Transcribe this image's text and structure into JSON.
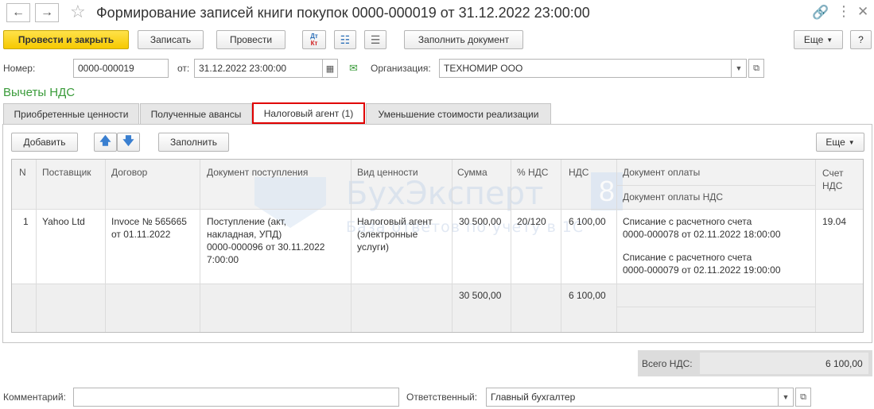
{
  "window": {
    "title": "Формирование записей книги покупок 0000-000019 от 31.12.2022 23:00:00"
  },
  "toolbar": {
    "post_close_label": "Провести и закрыть",
    "save_label": "Записать",
    "post_label": "Провести",
    "dt_label": "Дт",
    "kt_label": "Кт",
    "fill_doc_label": "Заполнить документ",
    "more_label": "Еще",
    "help_label": "?"
  },
  "header": {
    "number_label": "Номер:",
    "number_value": "0000-000019",
    "date_label": "от:",
    "date_value": "31.12.2022 23:00:00",
    "org_label": "Организация:",
    "org_value": "ТЕХНОМИР ООО"
  },
  "section_title": "Вычеты НДС",
  "tabs": [
    {
      "label": "Приобретенные ценности"
    },
    {
      "label": "Полученные авансы"
    },
    {
      "label": "Налоговый агент (1)"
    },
    {
      "label": "Уменьшение стоимости реализации"
    }
  ],
  "table_toolbar": {
    "add_label": "Добавить",
    "fill_label": "Заполнить",
    "more_label": "Еще"
  },
  "table": {
    "columns": {
      "n": "N",
      "supplier": "Поставщик",
      "contract": "Договор",
      "receipt_doc": "Документ поступления",
      "value_type": "Вид ценности",
      "amount": "Сумма",
      "vat_rate": "% НДС",
      "vat": "НДС",
      "payment_doc": "Документ оплаты",
      "payment_doc_vat": "Документ оплаты НДС",
      "vat_account": "Счет НДС"
    },
    "rows": [
      {
        "n": "1",
        "supplier": "Yahoo Ltd",
        "contract_1": "Invoce № 565665",
        "contract_2": "от 01.11.2022",
        "receipt_1": "Поступление (акт,",
        "receipt_2": "накладная, УПД)",
        "receipt_3": "0000-000096 от 30.11.2022",
        "receipt_4": "7:00:00",
        "value_type_1": "Налоговый агент",
        "value_type_2": "(электронные",
        "value_type_3": "услуги)",
        "amount": "30 500,00",
        "vat_rate": "20/120",
        "vat": "6 100,00",
        "payment_1a": "Списание с расчетного счета",
        "payment_1b": "0000-000078 от 02.11.2022 18:00:00",
        "payment_2a": "Списание с расчетного счета",
        "payment_2b": "0000-000079 от 02.11.2022 19:00:00",
        "vat_account": "19.04"
      }
    ],
    "totals": {
      "amount": "30 500,00",
      "vat": "6 100,00"
    }
  },
  "watermark": {
    "brand": "БухЭксперт",
    "digit": "8",
    "tagline": "База ответов по учету в 1С"
  },
  "summary": {
    "label": "Всего НДС:",
    "value": "6 100,00"
  },
  "footer": {
    "comment_label": "Комментарий:",
    "comment_value": "",
    "responsible_label": "Ответственный:",
    "responsible_value": "Главный бухгалтер"
  },
  "colors": {
    "primary_button": "#f6c900",
    "section_title": "#3a9b3a",
    "active_tab_border": "#e00000",
    "up_down_arrows": "#3a7fd0"
  }
}
